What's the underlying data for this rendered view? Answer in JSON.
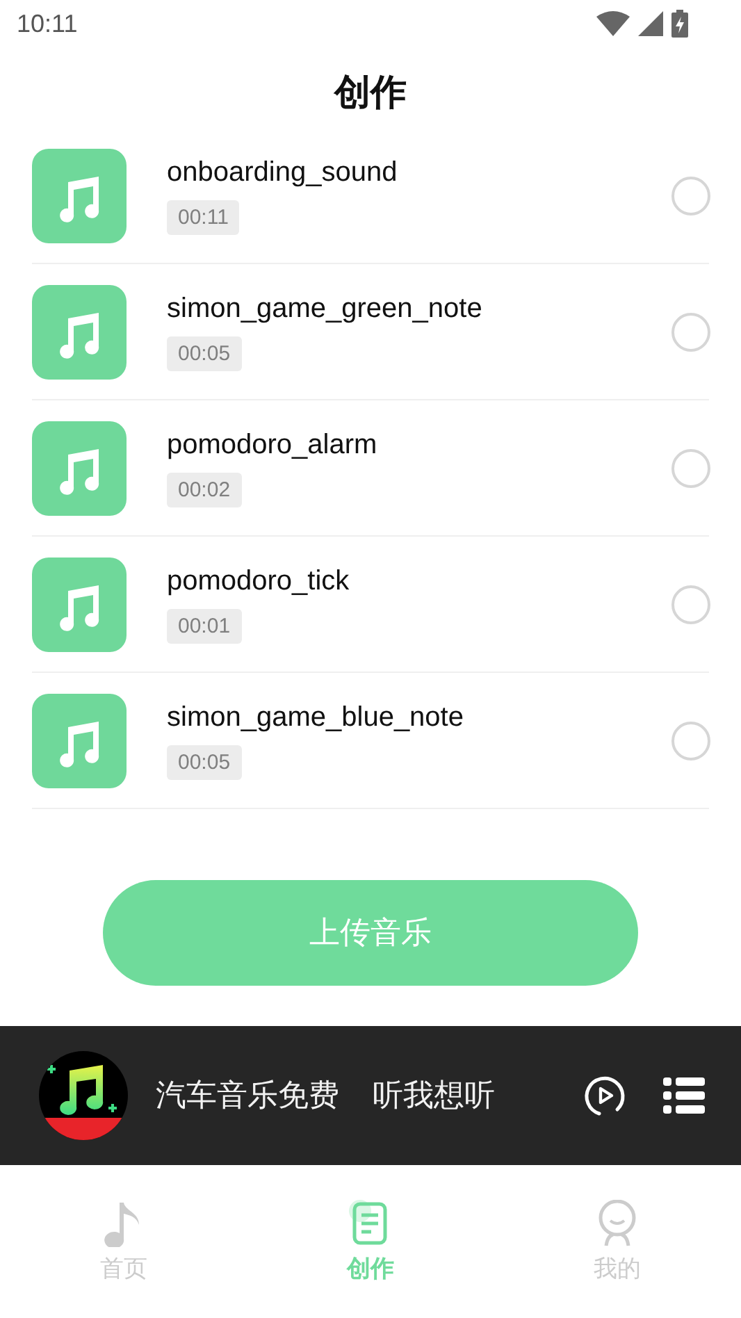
{
  "status_bar": {
    "time": "10:11"
  },
  "header": {
    "title": "创作"
  },
  "tracks": [
    {
      "name": "onboarding_sound",
      "duration": "00:11",
      "selected": false
    },
    {
      "name": "simon_game_green_note",
      "duration": "00:05",
      "selected": false
    },
    {
      "name": "pomodoro_alarm",
      "duration": "00:02",
      "selected": false
    },
    {
      "name": "pomodoro_tick",
      "duration": "00:01",
      "selected": false
    },
    {
      "name": "simon_game_blue_note",
      "duration": "00:05",
      "selected": false
    }
  ],
  "upload_button": {
    "label": "上传音乐"
  },
  "player": {
    "title": "汽车音乐免费",
    "subtitle": "听我想听"
  },
  "tabs": [
    {
      "kind": "music",
      "label": "首页",
      "selected": false
    },
    {
      "kind": "document",
      "label": "创作",
      "selected": true
    },
    {
      "kind": "person",
      "label": "我的",
      "selected": false
    }
  ]
}
